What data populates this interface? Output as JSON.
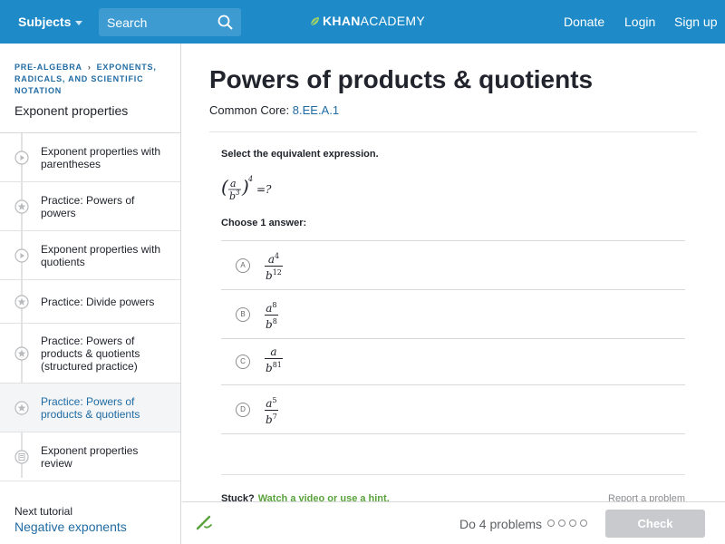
{
  "topbar": {
    "subjects_label": "Subjects",
    "search_placeholder": "Search",
    "logo_bold": "KHAN",
    "logo_light": "ACADEMY",
    "donate": "Donate",
    "login": "Login",
    "signup": "Sign up"
  },
  "sidebar": {
    "crumb_1": "PRE-ALGEBRA",
    "crumb_2": "EXPONENTS, RADICALS, AND SCIENTIFIC NOTATION",
    "tutorial_title": "Exponent properties",
    "items": [
      {
        "label": "Exponent properties with parentheses",
        "icon": "play-icon"
      },
      {
        "label": "Practice: Powers of powers",
        "icon": "star-icon"
      },
      {
        "label": "Exponent properties with quotients",
        "icon": "play-icon"
      },
      {
        "label": "Practice: Divide powers",
        "icon": "star-icon"
      },
      {
        "label": "Practice: Powers of products & quotients (structured practice)",
        "icon": "star-icon"
      },
      {
        "label": "Practice: Powers of products & quotients",
        "icon": "star-icon",
        "active": true
      },
      {
        "label": "Exponent properties review",
        "icon": "article-icon"
      }
    ],
    "next_label": "Next tutorial",
    "next_link": "Negative exponents"
  },
  "main": {
    "title": "Powers of products & quotients",
    "common_core_label": "Common Core:",
    "common_core_code": "8.EE.A.1",
    "question": "Select the equivalent expression.",
    "choose_label": "Choose 1 answer:",
    "choices": [
      {
        "letter": "A",
        "num": "a",
        "num_exp": "4",
        "den": "b",
        "den_exp": "12"
      },
      {
        "letter": "B",
        "num": "a",
        "num_exp": "8",
        "den": "b",
        "den_exp": "8"
      },
      {
        "letter": "C",
        "num": "a",
        "num_exp": "",
        "den": "b",
        "den_exp": "81"
      },
      {
        "letter": "D",
        "num": "a",
        "num_exp": "5",
        "den": "b",
        "den_exp": "7"
      }
    ],
    "stuck_label": "Stuck?",
    "stuck_link": "Watch a video or use a hint.",
    "report_link": "Report a problem"
  },
  "footer": {
    "do_problems": "Do 4 problems",
    "check_label": "Check"
  },
  "colors": {
    "topbar": "#1f8ac8",
    "link": "#1f6ba3",
    "hint_green": "#5aa33c",
    "check_disabled": "#c8cacd"
  }
}
